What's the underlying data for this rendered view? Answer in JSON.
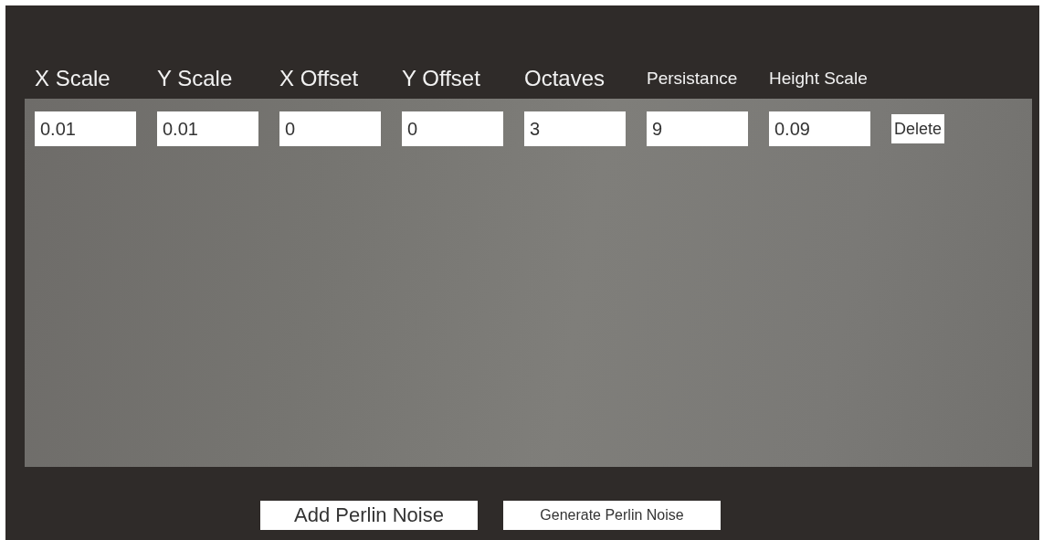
{
  "columns": [
    {
      "label": "X Scale",
      "kind": "large"
    },
    {
      "label": "Y Scale",
      "kind": "large"
    },
    {
      "label": "X Offset",
      "kind": "large"
    },
    {
      "label": "Y Offset",
      "kind": "large"
    },
    {
      "label": "Octaves",
      "kind": "large"
    },
    {
      "label": "Persistance",
      "kind": "small"
    },
    {
      "label": "Height Scale",
      "kind": "small"
    }
  ],
  "rows": [
    {
      "values": [
        "0.01",
        "0.01",
        "0",
        "0",
        "3",
        "9",
        "0.09"
      ],
      "delete_label": "Delete"
    }
  ],
  "buttons": [
    {
      "label": "Add Perlin Noise",
      "kind": "large"
    },
    {
      "label": "Generate Perlin Noise",
      "kind": "small"
    }
  ]
}
